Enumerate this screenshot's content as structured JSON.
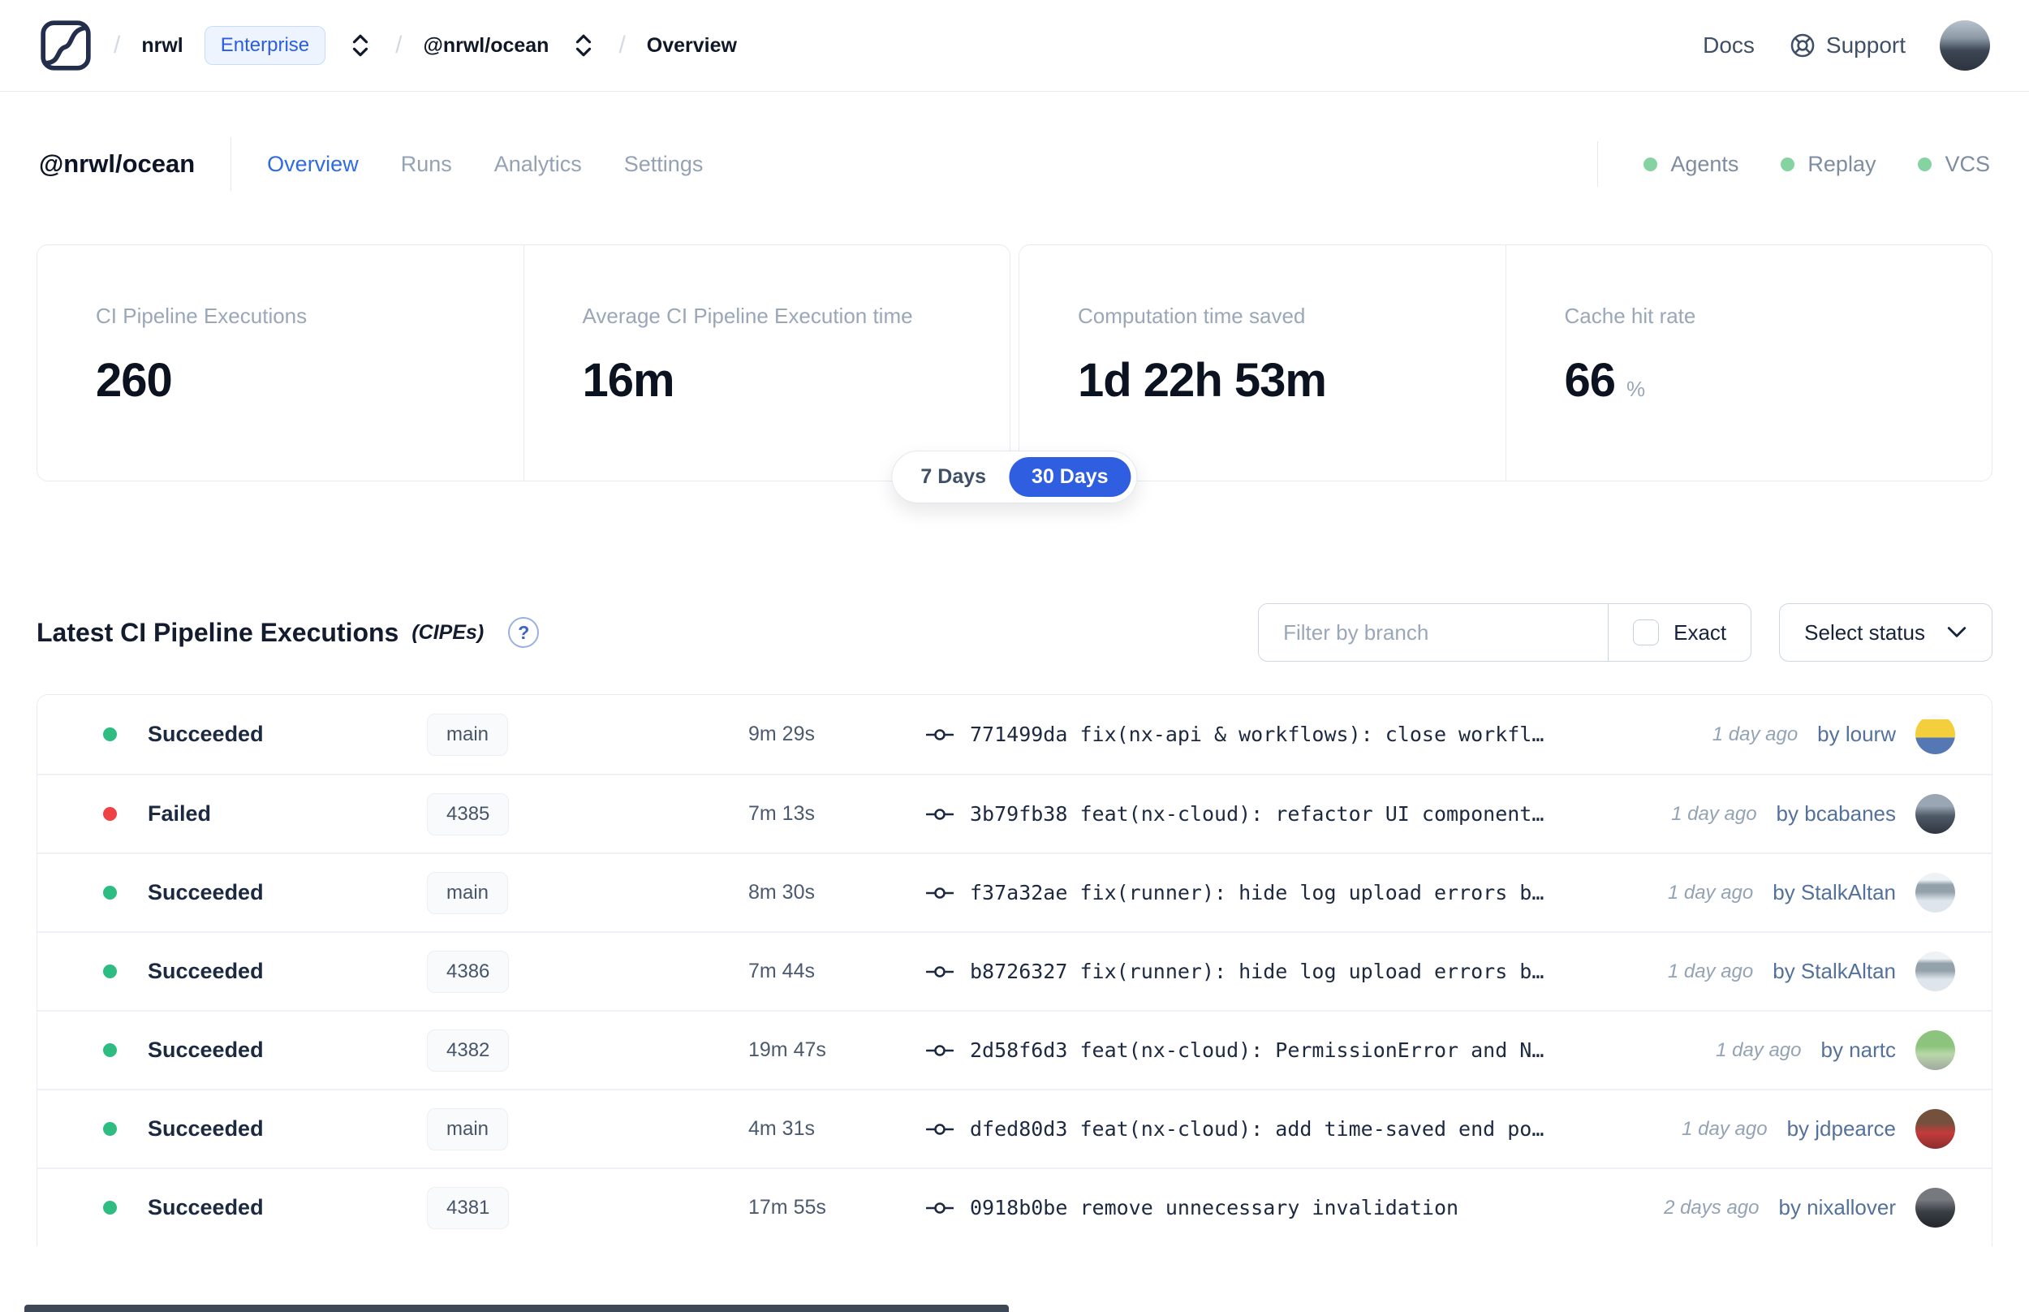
{
  "header": {
    "separator": "/",
    "org": "nrwl",
    "org_badge": "Enterprise",
    "workspace": "@nrwl/ocean",
    "page": "Overview",
    "docs_label": "Docs",
    "support_label": "Support"
  },
  "workspace": {
    "title": "@nrwl/ocean",
    "tabs": [
      {
        "label": "Overview",
        "active": true
      },
      {
        "label": "Runs",
        "active": false
      },
      {
        "label": "Analytics",
        "active": false
      },
      {
        "label": "Settings",
        "active": false
      }
    ],
    "features": [
      {
        "label": "Agents"
      },
      {
        "label": "Replay"
      },
      {
        "label": "VCS"
      }
    ]
  },
  "stats": {
    "cards": [
      {
        "label": "CI Pipeline Executions",
        "value": "260",
        "suffix": ""
      },
      {
        "label": "Average CI Pipeline Execution time",
        "value": "16m",
        "suffix": ""
      },
      {
        "label": "Computation time saved",
        "value": "1d 22h 53m",
        "suffix": ""
      },
      {
        "label": "Cache hit rate",
        "value": "66",
        "suffix": "%"
      }
    ],
    "range_toggle": {
      "options": [
        "7 Days",
        "30 Days"
      ],
      "selected": "30 Days"
    }
  },
  "pipelines": {
    "title": "Latest CI Pipeline Executions",
    "title_suffix": "(CIPEs)",
    "help_icon": "?",
    "filter_placeholder": "Filter by branch",
    "filter_value": "",
    "exact_label": "Exact",
    "status_select_label": "Select status",
    "rows": [
      {
        "status": "Succeeded",
        "branch": "main",
        "duration": "9m 29s",
        "commit": "771499da fix(nx-api & workflows): close workfl…",
        "time": "1 day ago",
        "author": "by lourw",
        "avatar": "minion"
      },
      {
        "status": "Failed",
        "branch": "4385",
        "duration": "7m 13s",
        "commit": "3b79fb38 feat(nx-cloud): refactor UI component…",
        "time": "1 day ago",
        "author": "by bcabanes",
        "avatar": "dark"
      },
      {
        "status": "Succeeded",
        "branch": "main",
        "duration": "8m 30s",
        "commit": "f37a32ae fix(runner): hide log upload errors b…",
        "time": "1 day ago",
        "author": "by StalkAltan",
        "avatar": "light"
      },
      {
        "status": "Succeeded",
        "branch": "4386",
        "duration": "7m 44s",
        "commit": "b8726327 fix(runner): hide log upload errors b…",
        "time": "1 day ago",
        "author": "by StalkAltan",
        "avatar": "light"
      },
      {
        "status": "Succeeded",
        "branch": "4382",
        "duration": "19m 47s",
        "commit": "2d58f6d3 feat(nx-cloud): PermissionError and N…",
        "time": "1 day ago",
        "author": "by nartc",
        "avatar": "green"
      },
      {
        "status": "Succeeded",
        "branch": "main",
        "duration": "4m 31s",
        "commit": "dfed80d3 feat(nx-cloud): add time-saved end po…",
        "time": "1 day ago",
        "author": "by jdpearce",
        "avatar": "red"
      },
      {
        "status": "Succeeded",
        "branch": "4381",
        "duration": "17m 55s",
        "commit": "0918b0be remove unnecessary invalidation",
        "time": "2 days ago",
        "author": "by nixallover",
        "avatar": "dusk"
      }
    ]
  },
  "colors": {
    "accent_blue": "#2f5ee0",
    "success_green": "#2dbd82",
    "failure_red": "#ee4244",
    "feature_green": "#86d3a2"
  }
}
